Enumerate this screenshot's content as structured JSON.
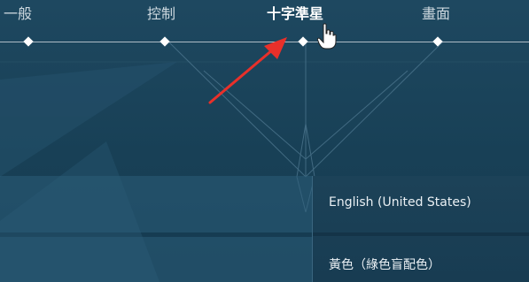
{
  "tabs": [
    {
      "label": "一般",
      "active": false
    },
    {
      "label": "控制",
      "active": false
    },
    {
      "label": "十字準星",
      "active": true
    },
    {
      "label": "畫面",
      "active": false
    }
  ],
  "dropdown": {
    "options": [
      "English (United States)",
      "黃色（綠色盲配色）"
    ]
  },
  "colors": {
    "background": "#1a4259",
    "tab_active": "#ffffff",
    "tab_inactive": "#cdd8df",
    "annotation_arrow": "#e8302a"
  }
}
